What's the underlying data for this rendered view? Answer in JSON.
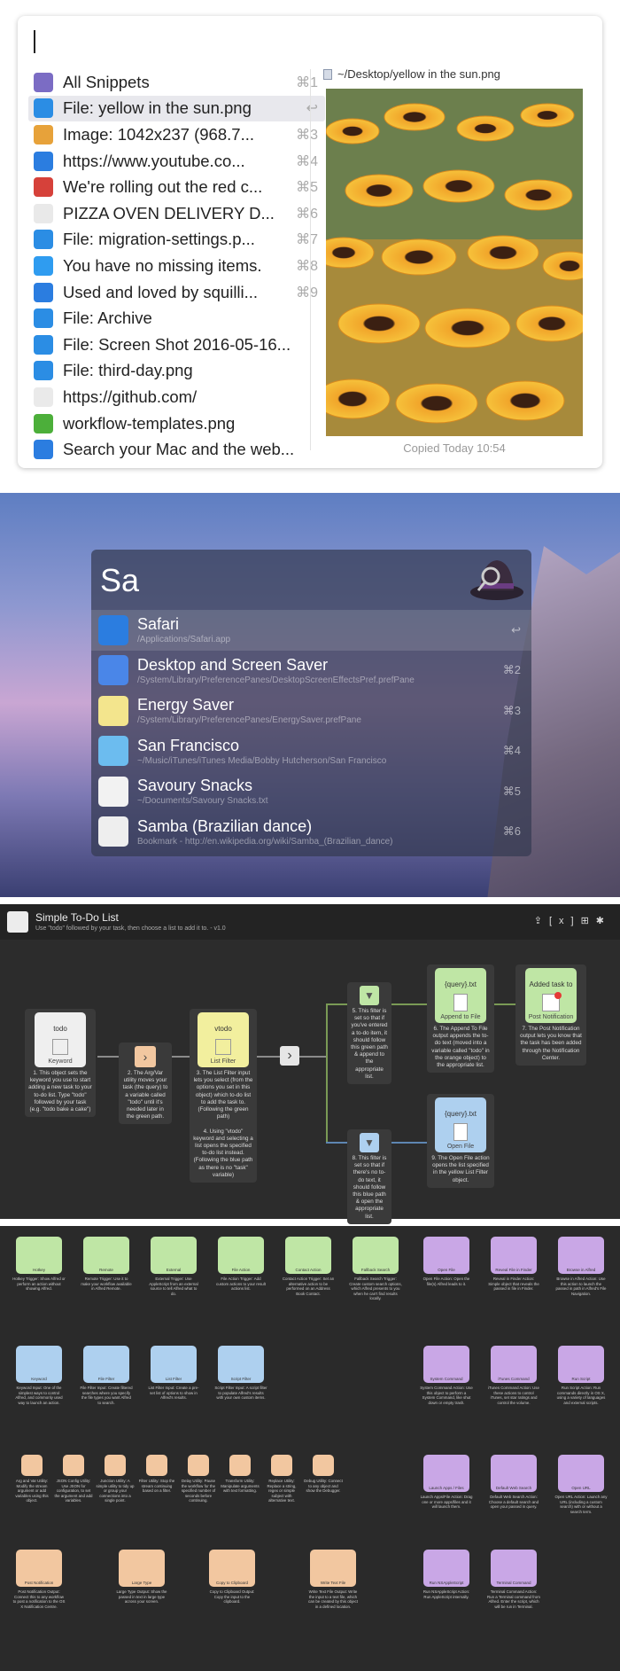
{
  "clipboard": {
    "items": [
      {
        "text": "All Snippets",
        "key": "⌘1",
        "icon": "snippets-icon",
        "color": "#7b6cc4"
      },
      {
        "text": "File: yellow in the sun.png",
        "key": "↩",
        "icon": "finder-icon",
        "color": "#2b8de4",
        "selected": true
      },
      {
        "text": "Image: 1042x237 (968.7...",
        "key": "⌘3",
        "icon": "image-icon",
        "color": "#e7a23a"
      },
      {
        "text": "https://www.youtube.co...",
        "key": "⌘4",
        "icon": "safari-icon",
        "color": "#2b7de0"
      },
      {
        "text": "We're rolling out the red c...",
        "key": "⌘5",
        "icon": "preview-icon",
        "color": "#d6413a"
      },
      {
        "text": "PIZZA OVEN DELIVERY D...",
        "key": "⌘6",
        "icon": "calendar-icon",
        "color": "#e9e9e9"
      },
      {
        "text": "File: migration-settings.p...",
        "key": "⌘7",
        "icon": "finder-icon",
        "color": "#2b8de4"
      },
      {
        "text": "You have no missing items.",
        "key": "⌘8",
        "icon": "messages-icon",
        "color": "#2f9cf0"
      },
      {
        "text": "Used and loved by squilli...",
        "key": "⌘9",
        "icon": "safari-icon",
        "color": "#2b7de0"
      },
      {
        "text": "File: Archive",
        "key": "",
        "icon": "finder-icon",
        "color": "#2b8de4"
      },
      {
        "text": "File: Screen Shot 2016-05-16...",
        "key": "",
        "icon": "finder-icon",
        "color": "#2b8de4"
      },
      {
        "text": "File: third-day.png",
        "key": "",
        "icon": "finder-icon",
        "color": "#2b8de4"
      },
      {
        "text": "https://github.com/",
        "key": "",
        "icon": "textedit-icon",
        "color": "#eaeaea"
      },
      {
        "text": "workflow-templates.png",
        "key": "",
        "icon": "leaf-icon",
        "color": "#4caf3a"
      },
      {
        "text": "Search your Mac and the web...",
        "key": "",
        "icon": "safari-icon",
        "color": "#2b7de0"
      }
    ],
    "preview_path": "~/Desktop/yellow in the sun.png",
    "copied": "Copied Today 10:54"
  },
  "alfred": {
    "query": "Sa",
    "results": [
      {
        "title": "Safari",
        "sub": "/Applications/Safari.app",
        "key": "↩",
        "color": "#2b7de0",
        "selected": true
      },
      {
        "title": "Desktop and Screen Saver",
        "sub": "/System/Library/PreferencePanes/DesktopScreenEffectsPref.prefPane",
        "key": "⌘2",
        "color": "#4a86e8"
      },
      {
        "title": "Energy Saver",
        "sub": "/System/Library/PreferencePanes/EnergySaver.prefPane",
        "key": "⌘3",
        "color": "#f3e58d"
      },
      {
        "title": "San Francisco",
        "sub": "~/Music/iTunes/iTunes Media/Bobby Hutcherson/San Francisco",
        "key": "⌘4",
        "color": "#6cbcef"
      },
      {
        "title": "Savoury Snacks",
        "sub": "~/Documents/Savoury Snacks.txt",
        "key": "⌘5",
        "color": "#f2f2f2"
      },
      {
        "title": "Samba (Brazilian dance)",
        "sub": "Bookmark - http://en.wikipedia.org/wiki/Samba_(Brazilian_dance)",
        "key": "⌘6",
        "color": "#eeeeee"
      }
    ]
  },
  "workflow": {
    "title": "Simple To-Do List",
    "subtitle": "Use \"todo\" followed by your task, then choose a list to add it to. - v1.0",
    "nodes": {
      "keyword": {
        "head": "todo",
        "label": "Keyword",
        "desc": "1. This object sets the keyword you use to start adding a new task to your to-do list. Type \"todo\" followed by your task (e.g. \"todo bake a cake\")"
      },
      "argvar": {
        "desc": "2. The Arg/Var utility moves your task (the query) to a variable called \"todo\" until it's needed later in the green path."
      },
      "listfilter": {
        "head": "vtodo",
        "label": "List Filter",
        "desc": "3. The List Filter input lets you select (from the options you set in this object) which to-do list to add the task to. (Following the green path)\n\n4. Using \"vtodo\" keyword and selecting a list opens the specified to-do list instead. (Following the blue path as there is no \"task\" variable)"
      },
      "filter1": {
        "desc": "5. This filter is set so that if you've entered a to-do item, it should follow this green path & append to the appropriate list."
      },
      "append": {
        "head": "{query}.txt",
        "label": "Append to File",
        "desc": "6. The Append To File output appends the to-do text (moved into a variable called \"todo\" in the orange object) to the appropriate list."
      },
      "notify": {
        "head": "Added task to {...",
        "label": "Post Notification",
        "desc": "7. The Post Notification output lets you know that the task has been added through the Notification Center."
      },
      "filter2": {
        "desc": "8. This filter is set so that if there's no to-do text, it should follow this blue path & open the appropriate list."
      },
      "openfile": {
        "head": "{query}.txt",
        "label": "Open File",
        "desc": "9. The Open File action opens the list specified in the yellow List Filter object."
      }
    }
  },
  "objects": [
    {
      "name": "Hotkey",
      "desc": "Hotkey Trigger: Show Alfred or perform an action without showing Alfred.",
      "c": "g"
    },
    {
      "name": "Remote",
      "desc": "Remote Trigger: Use it to make your workflow available in Alfred Remote.",
      "c": "g"
    },
    {
      "name": "External",
      "desc": "External Trigger: Use AppleScript from an external source to tell Alfred what to do.",
      "c": "g"
    },
    {
      "name": "File Action",
      "desc": "File Action Trigger: Add custom actions to your result actions list.",
      "c": "g"
    },
    {
      "name": "Contact Action",
      "desc": "Contact Action Trigger: Set an alternative action to be performed on an Address Book Contact.",
      "c": "g"
    },
    {
      "name": "Fallback Search",
      "desc": "Fallback Search Trigger: Create custom search options, which Alfred presents to you when he can't find results locally.",
      "c": "g"
    },
    {
      "name": "Open File",
      "desc": "Open File Action: Open the file(s) Alfred leads to it.",
      "c": "p"
    },
    {
      "name": "Reveal File in Finder",
      "desc": "Reveal in Finder Action: Simple object that reveals the passed in file in Finder.",
      "c": "p"
    },
    {
      "name": "Browse in Alfred",
      "desc": "Browse in Alfred Action: Use this action to launch the passed in path in Alfred's File Navigation.",
      "c": "p"
    },
    {
      "name": "Keyword",
      "desc": "Keyword Input: One of the simplest ways to control Alfred, and commonly used way to launch an action.",
      "c": "b"
    },
    {
      "name": "File Filter",
      "desc": "File Filter Input: Create filtered searches where you specify the file types you want Alfred to search.",
      "c": "b"
    },
    {
      "name": "List Filter",
      "desc": "List Filter Input: Create a pre-set list of options to show in Alfred's results.",
      "c": "b"
    },
    {
      "name": "Script Filter",
      "desc": "Script Filter Input: A script filter to populate Alfred's results with your own custom items.",
      "c": "b"
    },
    {
      "name": "System Command",
      "desc": "System Command Action: Use this object to perform a System Command, like shut down or empty trash.",
      "c": "p"
    },
    {
      "name": "iTunes Command",
      "desc": "iTunes Command Action: Use these actions to control iTunes, set star ratings and control the volume.",
      "c": "p"
    },
    {
      "name": "Run Script",
      "desc": "Run Script Action: Run commands directly in OS X, using a variety of languages and external scripts.",
      "c": "p"
    },
    {
      "name": "Arg and Vars",
      "desc": "Arg and Var Utility: Modify the stream argument or add variables using this object.",
      "c": "o"
    },
    {
      "name": "JSON Config",
      "desc": "JSON Config Utility: Use JSON for configuration, to set the argument and add variables.",
      "c": "o"
    },
    {
      "name": "Junction",
      "desc": "Junction Utility: A simple utility to tidy up or group your connections into a single point.",
      "c": "o"
    },
    {
      "name": "Filter",
      "desc": "Filter Utility: Stop the stream continuing based on a filter.",
      "c": "o"
    },
    {
      "name": "Delay",
      "desc": "Delay Utility: Pause the workflow for the specified number of seconds before continuing.",
      "c": "o"
    },
    {
      "name": "Transform",
      "desc": "Transform Utility: Manipulate arguments with text formatting.",
      "c": "o"
    },
    {
      "name": "Replace",
      "desc": "Replace Utility: Replace a string, regex or simple subject with alternative text.",
      "c": "o"
    },
    {
      "name": "Debug",
      "desc": "Debug Utility: Connect to any object and show the Debugger.",
      "c": "o"
    },
    {
      "name": "Launch Apps / Files",
      "desc": "Launch Apps/File Action: Drag one or more apps/files and it will launch them.",
      "c": "p"
    },
    {
      "name": "Default Web Search",
      "desc": "Default Web Search Action: Choose a default search and open your passed in query.",
      "c": "p"
    },
    {
      "name": "Open URL",
      "desc": "Open URL Action: Launch any URL (including a custom search) with or without a search term.",
      "c": "p"
    },
    {
      "name": "Post Notification",
      "desc": "Post Notification Output: Connect this to any workflow to post a notification to the OS X Notification Centre.",
      "c": "o"
    },
    {
      "name": "Large Type",
      "desc": "Large Type Output: Show the passed in text in large type across your screen.",
      "c": "o"
    },
    {
      "name": "Copy to Clipboard",
      "desc": "Copy to Clipboard Output: Copy the input to the clipboard.",
      "c": "o"
    },
    {
      "name": "Write Text File",
      "desc": "Write Text File Output: Write the input to a text file, which can be created by this object in a defined location.",
      "c": "o"
    },
    {
      "name": "Run NSAppleScript",
      "desc": "Run NSAppleScript Action: Run AppleScript internally.",
      "c": "p"
    },
    {
      "name": "Terminal Command",
      "desc": "Terminal Command Action: Run a Terminal command from Alfred. Enter the script, which will be run in Terminal.",
      "c": "p"
    }
  ]
}
